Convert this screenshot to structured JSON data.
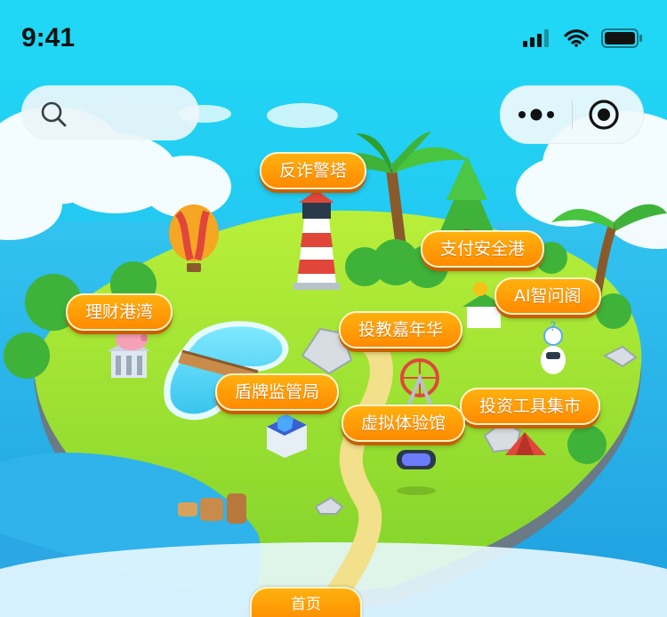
{
  "status_bar": {
    "time": "9:41"
  },
  "map_labels": {
    "anti_fraud_tower": "反诈警塔",
    "payment_safety_port": "支付安全港",
    "ai_pavilion": "AI智问阁",
    "wealth_bay": "理财港湾",
    "investor_carnival": "投教嘉年华",
    "shield_regulator": "盾牌监管局",
    "investment_tools_market": "投资工具集市",
    "virtual_experience_hall": "虚拟体验馆"
  },
  "bottom_tab": {
    "home_label": "首页"
  }
}
